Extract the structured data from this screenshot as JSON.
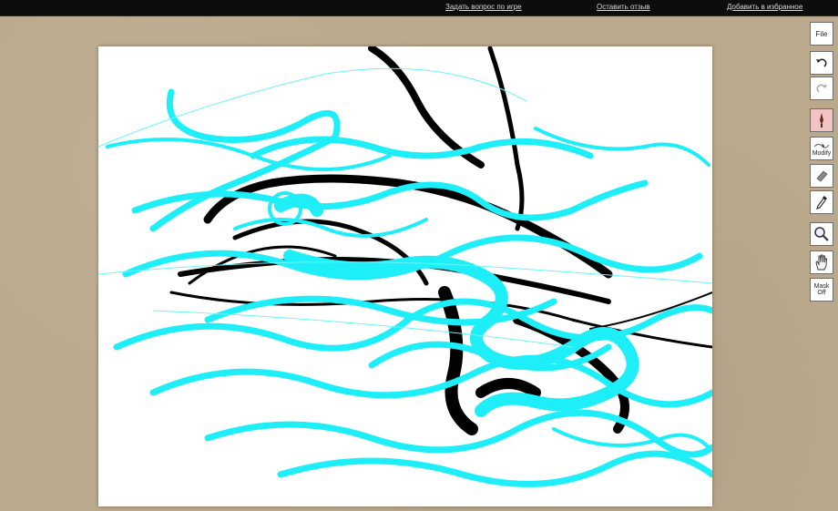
{
  "topbar": {
    "links": [
      {
        "label": "Задать вопрос по игре"
      },
      {
        "label": "Оставить отзыв"
      },
      {
        "label": "Добавить в избранное"
      }
    ]
  },
  "toolbar": {
    "file_label": "File",
    "undo_icon": "undo-icon",
    "redo_icon": "redo-icon",
    "brush_icon": "brush-icon",
    "modify_label": "Modify",
    "eraser_icon": "eraser-icon",
    "eyedropper_icon": "eyedropper-icon",
    "zoom_icon": "magnifier-icon",
    "pan_icon": "hand-icon",
    "mask_label_1": "Mask",
    "mask_label_2": "Off"
  },
  "colors": {
    "stroke_cyan": "#00f0ff",
    "stroke_black": "#000000",
    "active_tool": "#f2c3c3"
  }
}
